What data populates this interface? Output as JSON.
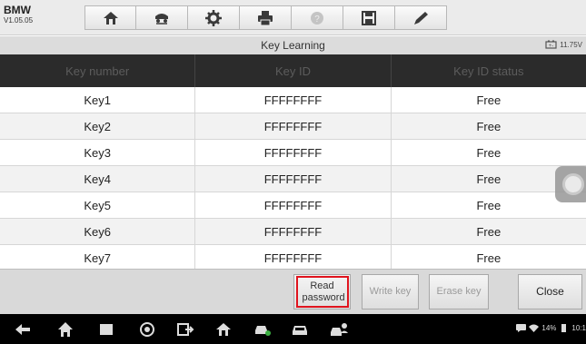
{
  "app": {
    "model": "BMW",
    "version": "V1.05.05"
  },
  "toolbar": {
    "icons": [
      "home-icon",
      "vehicle-swap-icon",
      "settings-icon",
      "print-icon",
      "help-icon",
      "save-icon",
      "edit-icon"
    ]
  },
  "titlebar": {
    "title": "Key Learning",
    "voltage": "11.75V"
  },
  "table": {
    "headers": [
      "Key number",
      "Key ID",
      "Key ID status"
    ],
    "rows": [
      [
        "Key1",
        "FFFFFFFF",
        "Free"
      ],
      [
        "Key2",
        "FFFFFFFF",
        "Free"
      ],
      [
        "Key3",
        "FFFFFFFF",
        "Free"
      ],
      [
        "Key4",
        "FFFFFFFF",
        "Free"
      ],
      [
        "Key5",
        "FFFFFFFF",
        "Free"
      ],
      [
        "Key6",
        "FFFFFFFF",
        "Free"
      ],
      [
        "Key7",
        "FFFFFFFF",
        "Free"
      ]
    ]
  },
  "actions": {
    "read_password": "Read password",
    "write_key": "Write key",
    "erase_key": "Erase key",
    "close": "Close"
  },
  "colors": {
    "highlight": "#e0141e",
    "header_bg": "#2b2b2b"
  },
  "statusbar": {
    "battery": "14%",
    "time": "10:1"
  }
}
